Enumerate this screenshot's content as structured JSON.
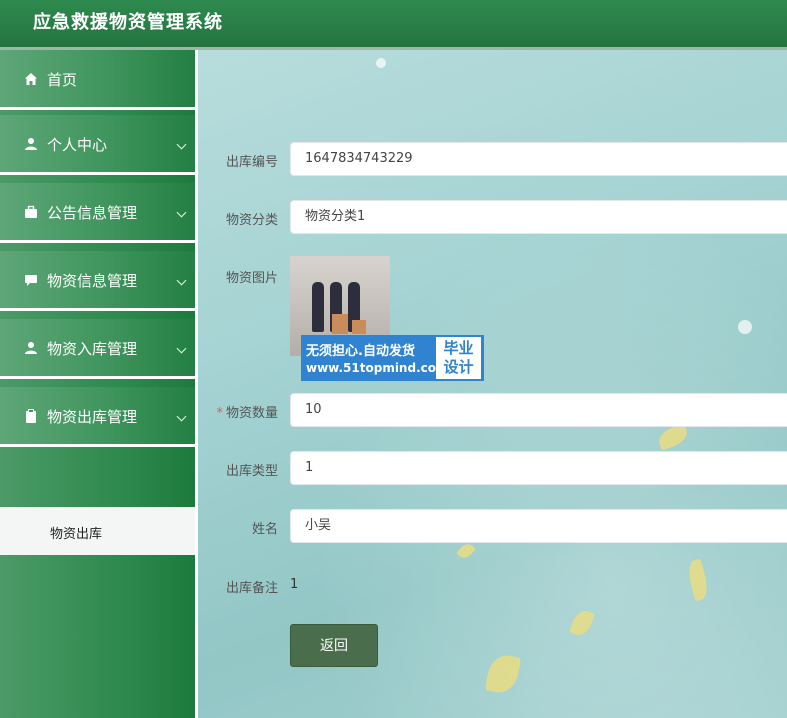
{
  "app": {
    "title": "应急救援物资管理系统"
  },
  "sidebar": {
    "items": [
      {
        "label": "首页",
        "icon": "home-icon"
      },
      {
        "label": "个人中心",
        "icon": "user-icon"
      },
      {
        "label": "公告信息管理",
        "icon": "briefcase-icon"
      },
      {
        "label": "物资信息管理",
        "icon": "chat-bubble-icon"
      },
      {
        "label": "物资入库管理",
        "icon": "user-icon"
      },
      {
        "label": "物资出库管理",
        "icon": "clipboard-icon"
      }
    ],
    "submenu": {
      "label": "物资出库"
    }
  },
  "form": {
    "outbound_no": {
      "label": "出库编号",
      "value": "1647834743229"
    },
    "category": {
      "label": "物资分类",
      "value": "物资分类1"
    },
    "image": {
      "label": "物资图片"
    },
    "quantity": {
      "label": "物资数量",
      "required_mark": "*",
      "value": "10"
    },
    "outbound_type": {
      "label": "出库类型",
      "value": "1"
    },
    "name": {
      "label": "姓名",
      "value": "小吴"
    },
    "remark": {
      "label": "出库备注",
      "value": "1"
    },
    "back_button": "返回"
  },
  "watermark": {
    "line1": "无须担心.自动发货",
    "line2": "www.51topmind.com",
    "badge_line1": "毕业",
    "badge_line2": "设计"
  },
  "colors": {
    "header": "#2a7f48",
    "sidebar": "#3f955d",
    "button": "#4a6e4c",
    "required": "#e25757"
  }
}
